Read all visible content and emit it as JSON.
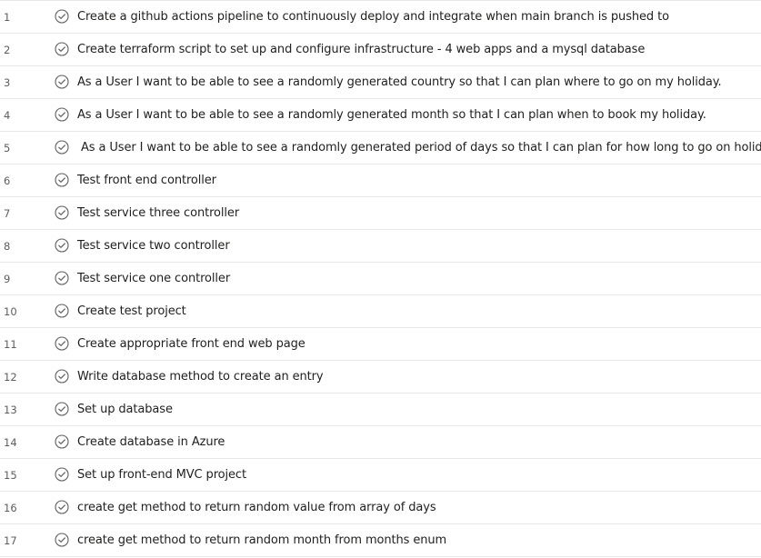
{
  "items": [
    {
      "number": "1",
      "title": "Create a github actions pipeline to continuously deploy and integrate when main branch is pushed to",
      "state": "completed"
    },
    {
      "number": "2",
      "title": "Create terraform script to set up and configure infrastructure - 4 web apps and a mysql database",
      "state": "completed"
    },
    {
      "number": "3",
      "title": "As a User I want to be able to see a randomly generated country so that I can plan where to go on my holiday.",
      "state": "completed"
    },
    {
      "number": "4",
      "title": "As a User I want to be able to see a randomly generated month so that I can plan when to book my holiday.",
      "state": "completed"
    },
    {
      "number": "5",
      "title": "As a User I want to be able to see a randomly generated period of days so that I can plan for how long to go on holiday.",
      "state": "completed"
    },
    {
      "number": "6",
      "title": "Test front end controller",
      "state": "completed"
    },
    {
      "number": "7",
      "title": "Test service three controller",
      "state": "completed"
    },
    {
      "number": "8",
      "title": "Test service two controller",
      "state": "completed"
    },
    {
      "number": "9",
      "title": "Test service one controller",
      "state": "completed"
    },
    {
      "number": "10",
      "title": "Create test project",
      "state": "completed"
    },
    {
      "number": "11",
      "title": "Create appropriate front end web page",
      "state": "completed"
    },
    {
      "number": "12",
      "title": "Write database method to create an entry",
      "state": "completed"
    },
    {
      "number": "13",
      "title": "Set up database",
      "state": "completed"
    },
    {
      "number": "14",
      "title": "Create database in Azure",
      "state": "completed"
    },
    {
      "number": "15",
      "title": "Set up front-end MVC project",
      "state": "completed"
    },
    {
      "number": "16",
      "title": "create get method to return random value from array of days",
      "state": "completed"
    },
    {
      "number": "17",
      "title": "create get method to return random month from months enum",
      "state": "completed"
    }
  ],
  "icons": {
    "status": "check-circle-icon"
  },
  "colors": {
    "text": "#201f1e",
    "row_number": "#605e5c",
    "icon": "#5f5f5f",
    "divider": "#e8e8e8"
  }
}
